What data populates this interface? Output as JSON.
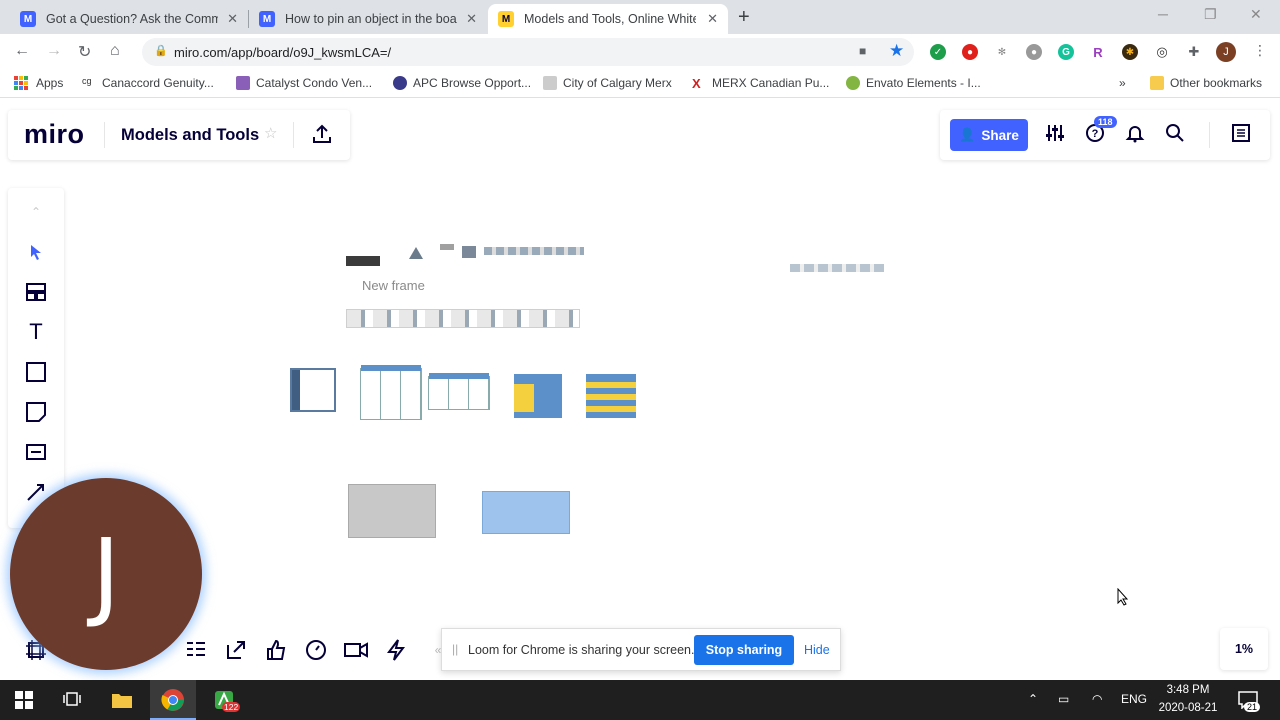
{
  "browser": {
    "tabs": [
      {
        "title": "Got a Question? Ask the Commu",
        "favicon": "miro-icon"
      },
      {
        "title": "How to pin an object in the boar",
        "favicon": "miro-icon"
      },
      {
        "title": "Models and Tools, Online Whiteb",
        "favicon": "miro-icon",
        "active": true
      }
    ],
    "url": "miro.com/app/board/o9J_kwsmLCA=/",
    "bookmarks": [
      {
        "label": "Apps"
      },
      {
        "label": "Canaccord Genuity..."
      },
      {
        "label": "Catalyst Condo Ven..."
      },
      {
        "label": "APC Browse Opport..."
      },
      {
        "label": "City of Calgary Merx"
      },
      {
        "label": "MERX Canadian Pu..."
      },
      {
        "label": "Envato Elements - I..."
      },
      {
        "label": "»"
      },
      {
        "label": "Other bookmarks"
      }
    ],
    "profile_initial": "J"
  },
  "miro": {
    "logo": "miro",
    "board_title": "Models and Tools",
    "share_label": "Share",
    "notifications_badge": "118",
    "frame_label": "New frame",
    "zoom": "1%",
    "accent_color": "#4262ff"
  },
  "loom": {
    "message": "Loom for Chrome is sharing your screen.",
    "stop_label": "Stop sharing",
    "hide_label": "Hide"
  },
  "avatar": {
    "initial": "J"
  },
  "taskbar": {
    "language": "ENG",
    "time": "3:48 PM",
    "date": "2020-08-21",
    "notification_count": "21",
    "app_badge": "122"
  }
}
